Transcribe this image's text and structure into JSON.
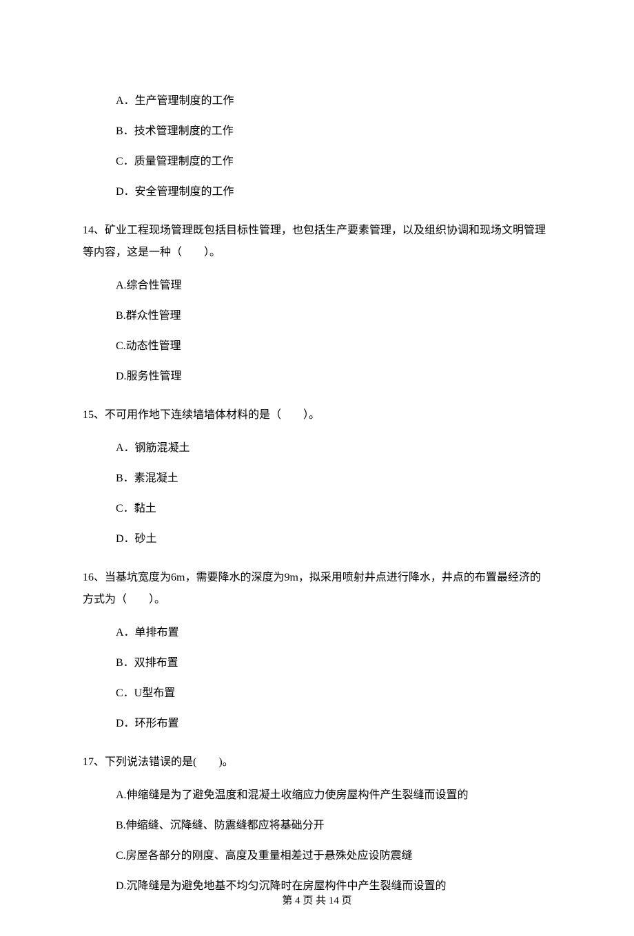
{
  "q13_options": {
    "a": "A．生产管理制度的工作",
    "b": "B．技术管理制度的工作",
    "c": "C．质量管理制度的工作",
    "d": "D．安全管理制度的工作"
  },
  "q14": {
    "stem": "14、矿业工程现场管理既包括目标性管理，也包括生产要素管理，以及组织协调和现场文明管理等内容，这是一种（　　）。",
    "a": "A.综合性管理",
    "b": "B.群众性管理",
    "c": "C.动态性管理",
    "d": "D.服务性管理"
  },
  "q15": {
    "stem": "15、不可用作地下连续墙墙体材料的是（　　）。",
    "a": "A．钢筋混凝土",
    "b": "B．素混凝土",
    "c": "C．黏土",
    "d": "D．砂土"
  },
  "q16": {
    "stem": "16、当基坑宽度为6m，需要降水的深度为9m，拟采用喷射井点进行降水，井点的布置最经济的方式为（　　）。",
    "a": "A．单排布置",
    "b": "B．双排布置",
    "c": "C．U型布置",
    "d": "D．环形布置"
  },
  "q17": {
    "stem": "17、下列说法错误的是(　　)。",
    "a": "A.伸缩缝是为了避免温度和混凝土收缩应力使房屋构件产生裂缝而设置的",
    "b": "B.伸缩缝、沉降缝、防震缝都应将基础分开",
    "c": "C.房屋各部分的刚度、高度及重量相差过于悬殊处应设防震缝",
    "d": "D.沉降缝是为避免地基不均匀沉降时在房屋构件中产生裂缝而设置的"
  },
  "footer": "第 4 页 共 14 页"
}
